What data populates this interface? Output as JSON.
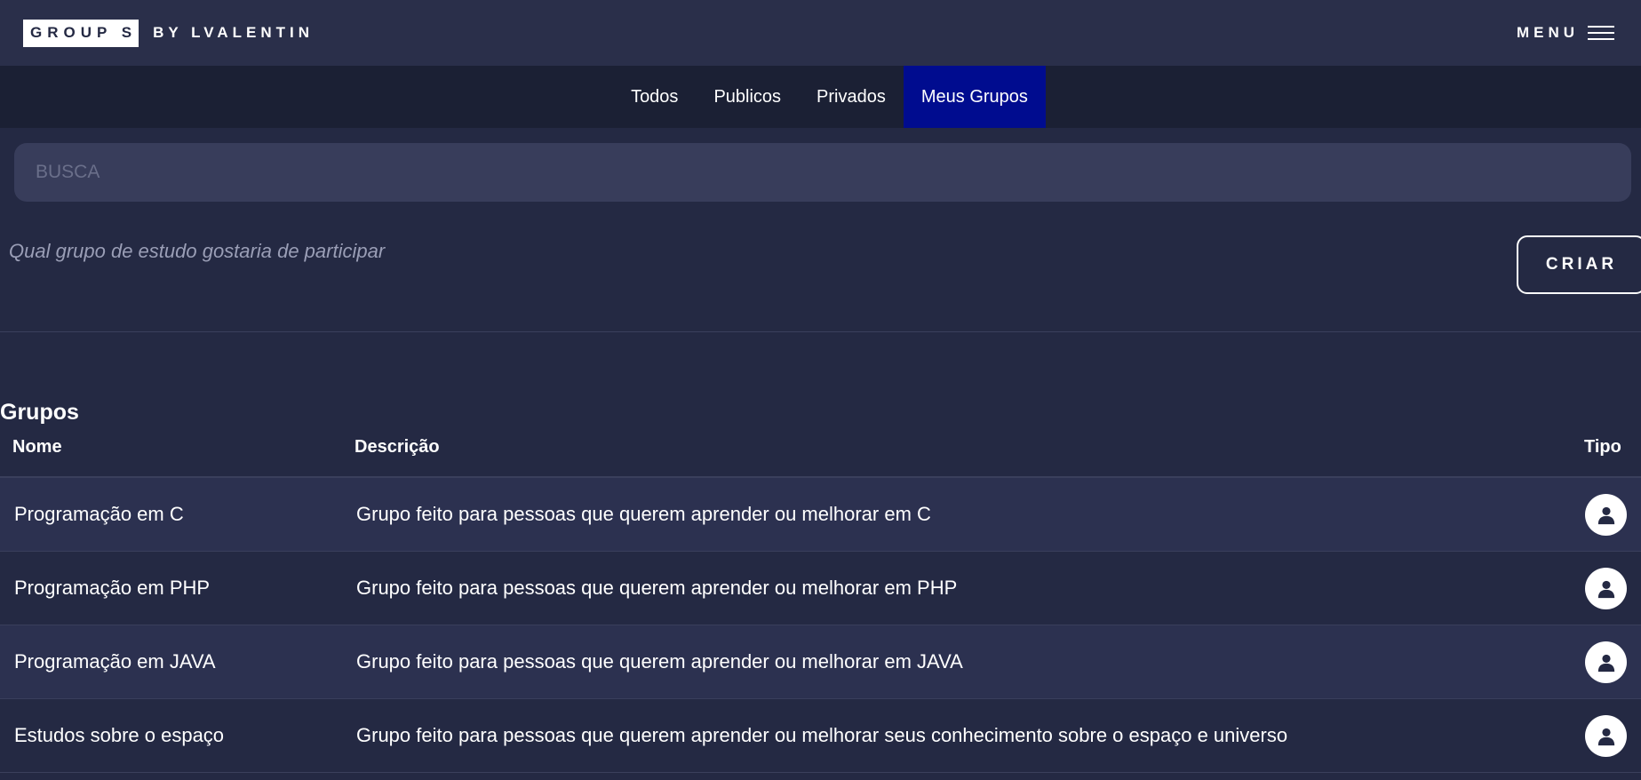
{
  "header": {
    "logo_text": "GROUP S",
    "logo_by": "BY LVALENTIN",
    "menu_label": "MENU",
    "menu_icon": "hamburger-icon"
  },
  "tabs": [
    {
      "label": "Todos",
      "active": false
    },
    {
      "label": "Publicos",
      "active": false
    },
    {
      "label": "Privados",
      "active": false
    },
    {
      "label": "Meus Grupos",
      "active": true
    }
  ],
  "search": {
    "placeholder": "BUSCA",
    "value": ""
  },
  "subtitle": "Qual grupo de estudo gostaria de participar",
  "create_button": "CRIAR",
  "table": {
    "title": "Grupos",
    "columns": {
      "name": "Nome",
      "description": "Descrição",
      "type": "Tipo"
    },
    "rows": [
      {
        "name": "Programação em C",
        "description": "Grupo feito para pessoas que querem aprender ou melhorar em C",
        "type_icon": "user-icon"
      },
      {
        "name": "Programação em PHP",
        "description": "Grupo feito para pessoas que querem aprender ou melhorar em PHP",
        "type_icon": "user-icon"
      },
      {
        "name": "Programação em JAVA",
        "description": "Grupo feito para pessoas que querem aprender ou melhorar em JAVA",
        "type_icon": "user-icon"
      },
      {
        "name": "Estudos sobre o espaço",
        "description": "Grupo feito para pessoas que querem aprender ou melhorar seus conhecimento sobre o espaço e universo",
        "type_icon": "user-icon"
      }
    ]
  },
  "colors": {
    "background": "#242943",
    "header": "#2a2f4a",
    "tabs_bar": "#1b2034",
    "active_tab": "#000c8f",
    "search": "#383d5b"
  }
}
